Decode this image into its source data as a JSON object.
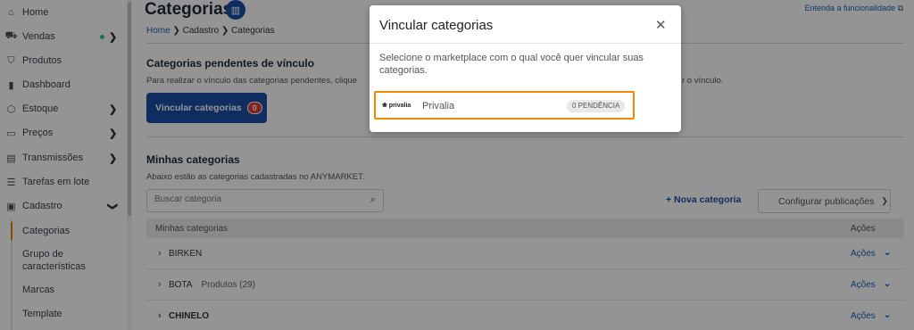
{
  "sidebar": {
    "items": [
      {
        "label": "Home",
        "icon": "home-icon",
        "glyph": "⌂"
      },
      {
        "label": "Vendas",
        "icon": "cart-icon",
        "glyph": "⛟"
      },
      {
        "label": "Produtos",
        "icon": "shirt-icon",
        "glyph": "⌂"
      },
      {
        "label": "Dashboard",
        "icon": "bar-chart-icon",
        "glyph": "▮"
      },
      {
        "label": "Estoque",
        "icon": "box-icon",
        "glyph": "⬡"
      },
      {
        "label": "Preços",
        "icon": "money-icon",
        "glyph": "▭"
      },
      {
        "label": "Transmissões",
        "icon": "calendar-icon",
        "glyph": "▤"
      },
      {
        "label": "Tarefas em lote",
        "icon": "list-icon",
        "glyph": "☰"
      },
      {
        "label": "Cadastro",
        "icon": "clipboard-icon",
        "glyph": "▣"
      }
    ],
    "sub_items": [
      "Categorias",
      "Grupo de características",
      "Marcas",
      "Template"
    ]
  },
  "header": {
    "title": "Categorias",
    "help_link": "Entenda a funcionalidade",
    "breadcrumb": {
      "home": "Home",
      "sep1": "❯",
      "cadastro": "Cadastro",
      "sep2": "❯",
      "current": "Categorias"
    }
  },
  "pending": {
    "title": "Categorias pendentes de vínculo",
    "desc_left": "Para realizar o vínculo das categorias pendentes, clique",
    "desc_right": "r o vínculo.",
    "button_label": "Vincular categorias",
    "button_badge": "0"
  },
  "mine": {
    "title": "Minhas categorias",
    "desc": "Abaixo estão as categorias cadastradas no ANYMARKET.",
    "search_placeholder": "Buscar categoria",
    "new_label": "+ Nova categoria",
    "config_label": "Configurar publicações",
    "col_name": "Minhas categorias",
    "col_actions": "Ações",
    "rows": [
      {
        "name": "BIRKEN",
        "count": "",
        "actions": "Ações"
      },
      {
        "name": "BOTA",
        "count": "Produtos (29)",
        "actions": "Ações"
      },
      {
        "name": "CHINELO",
        "count": "",
        "actions": "Ações"
      }
    ]
  },
  "modal": {
    "title": "Vincular categorias",
    "close": "✕",
    "text": "Selecione o marketplace com o qual você quer vincular suas categorias.",
    "marketplace": {
      "logo": "❀ privalia",
      "name": "Privalia",
      "badge": "0 PENDÊNCIA"
    }
  },
  "colors": {
    "primary": "#1b4fa8",
    "highlight": "#f08a00",
    "alert": "#e53935",
    "online": "#2ecc71"
  }
}
